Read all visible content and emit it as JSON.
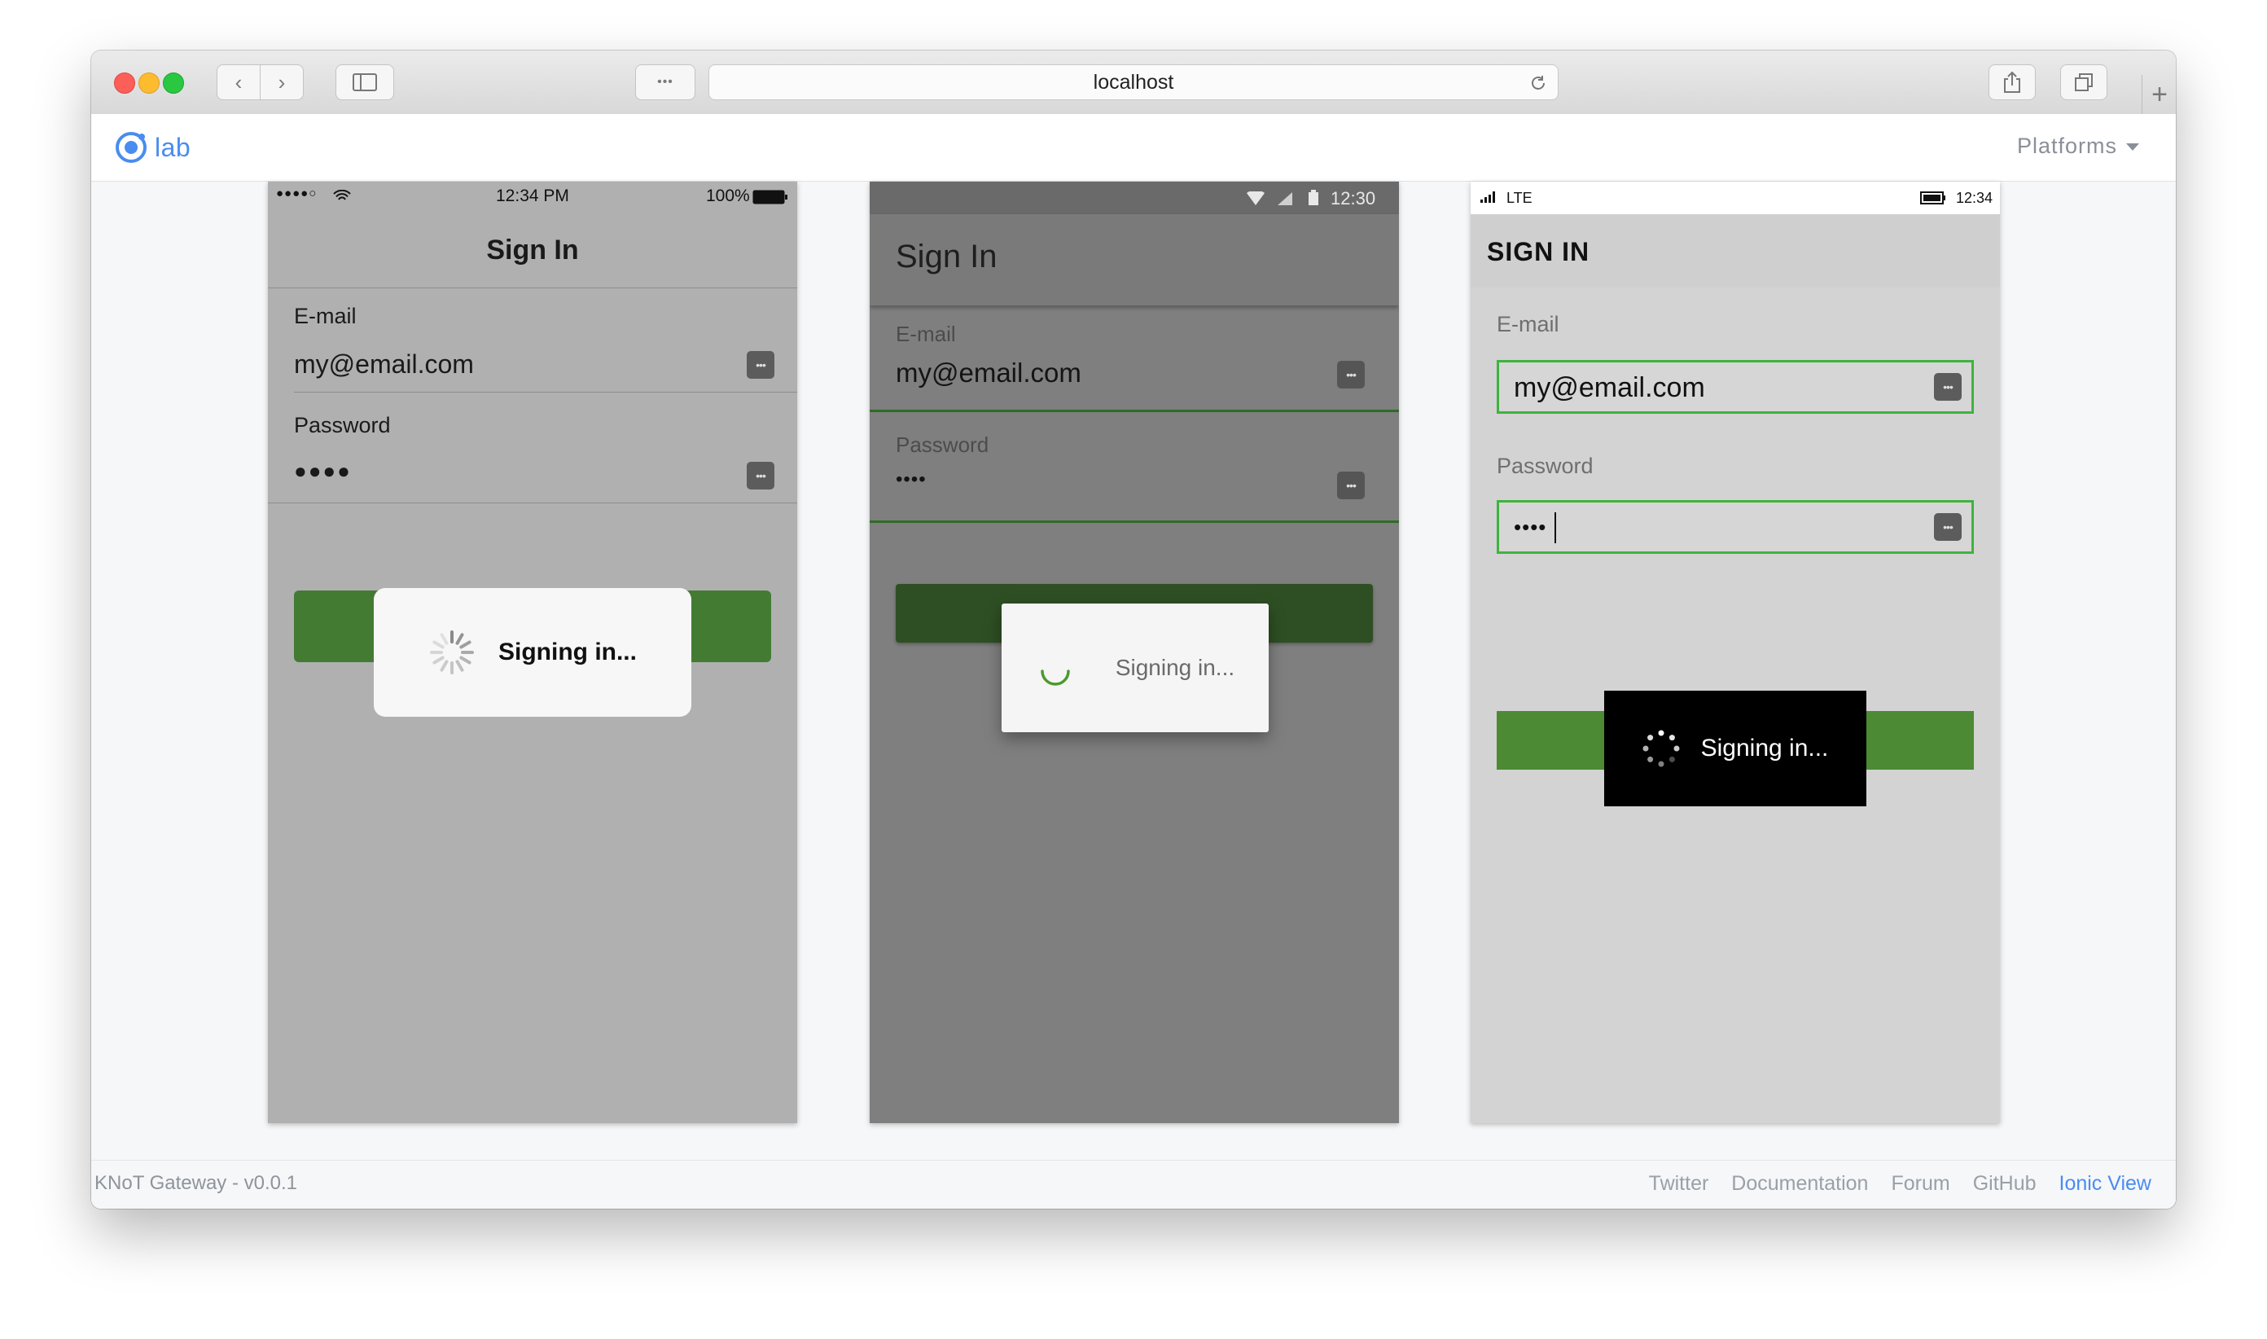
{
  "browser": {
    "url": "localhost",
    "controls": {
      "back": "‹",
      "forward": "›",
      "reader": "•••"
    }
  },
  "lab": {
    "logo_text": "lab",
    "platforms_label": "Platforms",
    "footer": {
      "version": "KNoT Gateway - v0.0.1",
      "links": [
        "Twitter",
        "Documentation",
        "Forum",
        "GitHub",
        "Ionic View"
      ]
    }
  },
  "ios": {
    "status": {
      "carrier": "●●●●○",
      "time": "12:34 PM",
      "battery": "100%"
    },
    "title": "Sign In",
    "email_label": "E-mail",
    "email_value": "my@email.com",
    "password_label": "Password",
    "password_value": "●●●●",
    "loading_text": "Signing in..."
  },
  "md": {
    "status": {
      "time": "12:30"
    },
    "title": "Sign In",
    "email_label": "E-mail",
    "email_value": "my@email.com",
    "password_label": "Password",
    "password_value": "••••",
    "loading_text": "Signing in..."
  },
  "wp": {
    "status": {
      "network": "LTE",
      "time": "12:34"
    },
    "title": "SIGN IN",
    "email_label": "E-mail",
    "email_value": "my@email.com",
    "password_label": "Password",
    "password_value": "••••",
    "loading_text": "Signing in..."
  },
  "colors": {
    "ionic_blue": "#4a8cf0",
    "ios_button_green": "#437b33",
    "md_button_green": "#2e4f23",
    "wp_button_green": "#4c8a33",
    "wp_focus_border": "#3fb33f"
  }
}
